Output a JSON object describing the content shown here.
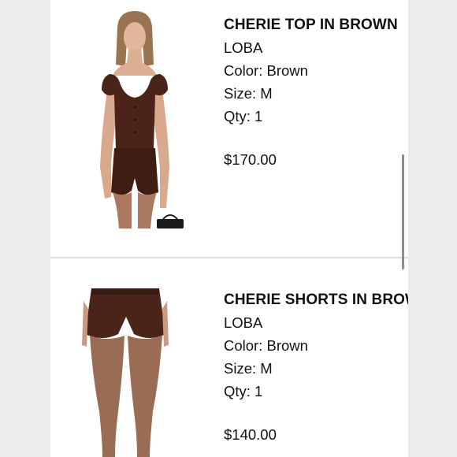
{
  "items": [
    {
      "name": "CHERIE TOP IN BROWN",
      "brand": "LOBA",
      "color": "Color: Brown",
      "size": "Size: M",
      "qty": "Qty: 1",
      "price": "$170.00"
    },
    {
      "name": "CHERIE SHORTS IN BROWN",
      "brand": "LOBA",
      "color": "Color: Brown",
      "size": "Size: M",
      "qty": "Qty: 1",
      "price": "$140.00"
    }
  ],
  "colors": {
    "background": "#ececec",
    "card": "#ffffff",
    "text": "#111111",
    "divider": "#dcdcdc",
    "garment": "#4a2418",
    "skin": "#d8a98c"
  }
}
